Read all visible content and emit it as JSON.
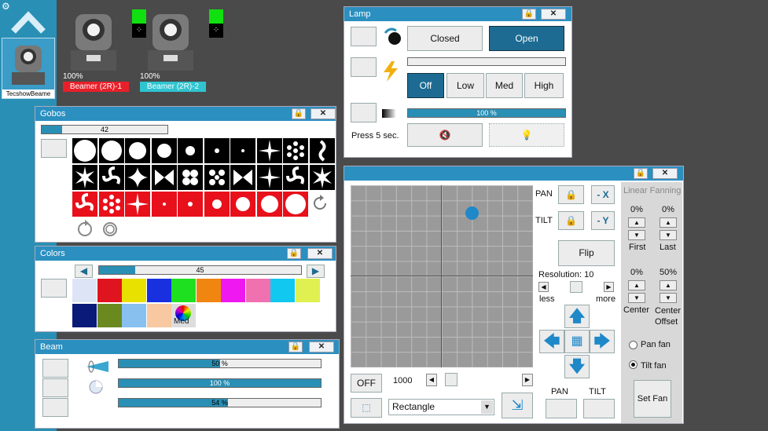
{
  "sidebar": {
    "app_label": "TecshowBeame"
  },
  "fixtures": [
    {
      "percent": "100%",
      "label": "Beamer (2R)-1",
      "label_color": "#e8202a"
    },
    {
      "percent": "100%",
      "label": "Beamer (2R)-2",
      "label_color": "#2ec4d0"
    }
  ],
  "lamp": {
    "title": "Lamp",
    "closed": "Closed",
    "open": "Open",
    "off": "Off",
    "low": "Low",
    "med": "Med",
    "high": "High",
    "dimmer": "100 %",
    "press": "Press 5 sec."
  },
  "gobos": {
    "title": "Gobos",
    "value": "42"
  },
  "colors": {
    "title": "Colors",
    "value": "45",
    "wheel_label": "Med",
    "swatches": [
      "#dde4f5",
      "#e0141e",
      "#e8e100",
      "#1830e0",
      "#1ee020",
      "#f08510",
      "#f018f0",
      "#f070b0",
      "#10c8f0",
      "#e0f050",
      "#0a1a78",
      "#6a8a20",
      "#88c0f0",
      "#f8c8a0"
    ]
  },
  "beam": {
    "title": "Beam",
    "bar1": "50 %",
    "bar2": "100 %",
    "bar3": "54 %"
  },
  "pantilt": {
    "pan": "PAN",
    "tilt": "TILT",
    "minus_x": "- X",
    "minus_y": "- Y",
    "flip": "Flip",
    "resolution": "Resolution: 10",
    "less": "less",
    "more": "more",
    "off": "OFF",
    "speed": "1000",
    "shape": "Rectangle",
    "pan_btn": "PAN",
    "tilt_btn": "TILT",
    "fan_title": "Linear Fanning",
    "first_val": "0%",
    "last_val": "0%",
    "first": "First",
    "last": "Last",
    "center_val": "0%",
    "offset_val": "50%",
    "center": "Center",
    "center_offset": "Center Offset",
    "pan_fan": "Pan fan",
    "tilt_fan": "Tilt fan",
    "set_fan": "Set Fan"
  },
  "accent": "#2b8fc0"
}
